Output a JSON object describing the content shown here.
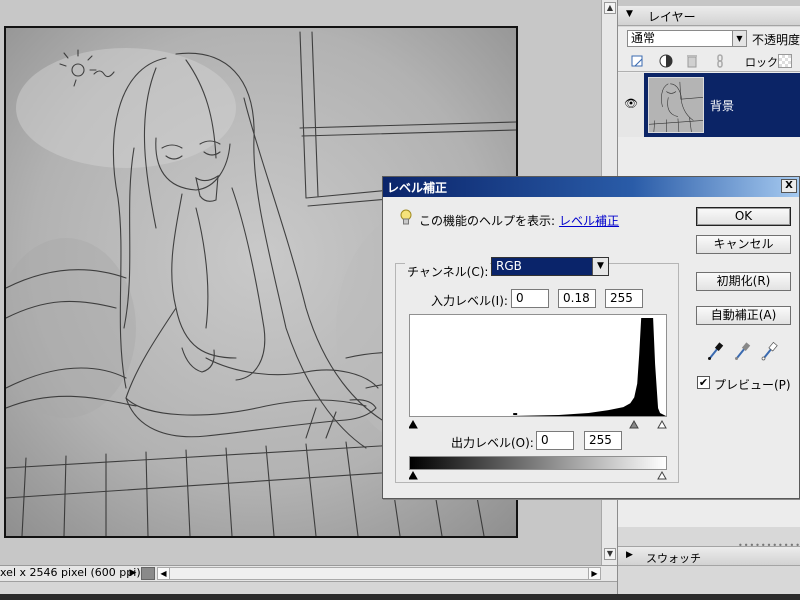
{
  "status_bar": {
    "size_text": "xel x 2546 pixel (600 ppi)",
    "menu_arrow": "▶"
  },
  "scroll": {
    "up": "▲",
    "down": "▼",
    "left": "◀",
    "right": "▶"
  },
  "layers_panel": {
    "title": "レイヤー",
    "collapse_icon": "▼",
    "blend_mode": "通常",
    "dropdown_icon": "▼",
    "opacity_label": "不透明度",
    "lock_label": "ロック:",
    "visibility_icon": "👁",
    "layer_name": "背景"
  },
  "swatches_panel": {
    "title": "スウォッチ",
    "expand_icon": "▶",
    "grip": "••••••••••••••"
  },
  "levels_dialog": {
    "title": "レベル補正",
    "close_label": "X",
    "help_text": "この機能のヘルプを表示:",
    "help_link": "レベル補正",
    "ok_label": "OK",
    "cancel_label": "キャンセル",
    "reset_label": "初期化(R)",
    "auto_label": "自動補正(A)",
    "channel_label": "チャンネル(C):",
    "channel_value": "RGB",
    "channel_arrow": "▼",
    "input_levels_label": "入力レベル(I):",
    "input_black": "0",
    "input_gamma": "0.18",
    "input_white": "255",
    "output_levels_label": "出力レベル(O):",
    "output_black": "0",
    "output_white": "255",
    "preview_label": "プレビュー(P)",
    "preview_checked": "✔"
  }
}
